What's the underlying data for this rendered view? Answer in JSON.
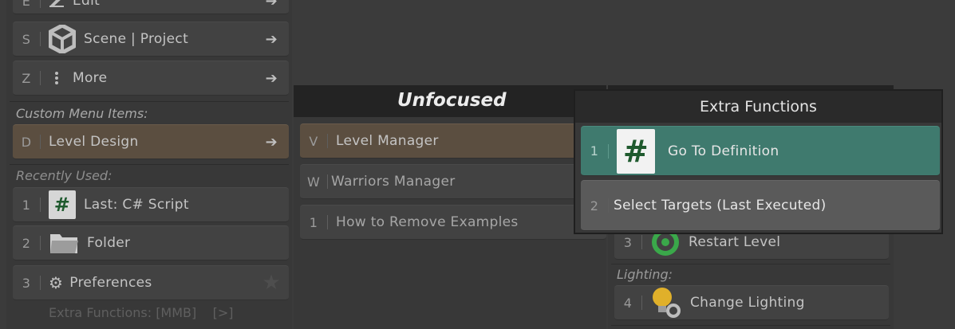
{
  "left_menu": {
    "top_items": [
      {
        "key": "E",
        "label": "Edit"
      },
      {
        "key": "S",
        "label": "Scene | Project"
      },
      {
        "key": "Z",
        "label": "More"
      }
    ],
    "custom_header": "Custom Menu Items:",
    "custom_items": [
      {
        "key": "D",
        "label": "Level Design"
      }
    ],
    "recent_header": "Recently Used:",
    "recent_items": [
      {
        "key": "1",
        "label": "Last:  C# Script"
      },
      {
        "key": "2",
        "label": "Folder"
      },
      {
        "key": "3",
        "label": "Preferences"
      }
    ],
    "footer": "Extra Functions: [MMB]    [>]"
  },
  "middle_menu": {
    "title": "Unfocused",
    "items": [
      {
        "key": "V",
        "label": "Level Manager"
      },
      {
        "key": "W",
        "label": "Warriors Manager"
      },
      {
        "key": "1",
        "label": "How to Remove Examples"
      }
    ]
  },
  "right_menu": {
    "items": [
      {
        "key": "3",
        "label": "Restart Level"
      }
    ],
    "lighting_header": "Lighting:",
    "lighting_items": [
      {
        "key": "4",
        "label": "Change Lighting"
      }
    ]
  },
  "popup": {
    "title": "Extra Functions",
    "items": [
      {
        "key": "1",
        "label": "Go To Definition"
      },
      {
        "key": "2",
        "label": "Select Targets (Last Executed)"
      }
    ]
  },
  "icons": {
    "cs_glyph": "#"
  },
  "colors": {
    "background": "#3b3b3b",
    "highlight_brown": "#5b4e40",
    "popup_selected": "#3f7a6e",
    "restart_green": "#3aa84a"
  }
}
